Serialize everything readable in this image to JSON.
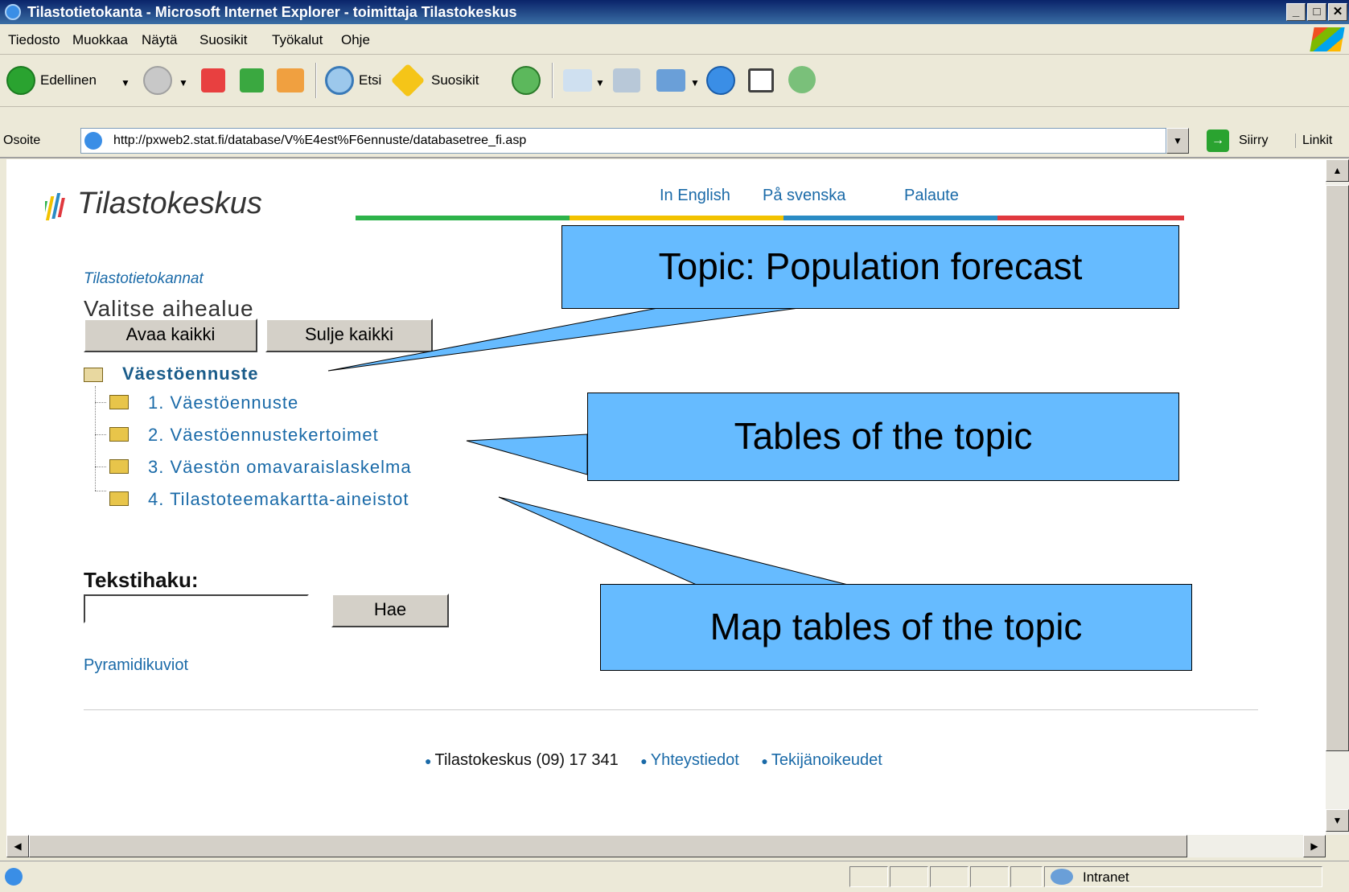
{
  "window": {
    "title": "Tilastotietokanta - Microsoft Internet Explorer - toimittaja Tilastokeskus",
    "minimize": "_",
    "maximize": "□",
    "close": "✕"
  },
  "menu": [
    "Tiedosto",
    "Muokkaa",
    "Näytä",
    "Suosikit",
    "Työkalut",
    "Ohje"
  ],
  "toolbar": {
    "back_label": "Edellinen",
    "search_label": "Etsi",
    "favorites_label": "Suosikit"
  },
  "address": {
    "label": "Osoite",
    "url": "http://pxweb2.stat.fi/database/V%E4est%F6ennuste/databasetree_fi.asp",
    "go_label": "Siirry",
    "links_label": "Linkit"
  },
  "page": {
    "logo_text": "Tilastokeskus",
    "nav": [
      "In English",
      "På svenska",
      "Palaute"
    ],
    "breadcrumb": "Tilastotietokannat",
    "heading": "Valitse aihealue",
    "open_all": "Avaa kaikki",
    "close_all": "Sulje kaikki",
    "tree": {
      "root": "Väestöennuste",
      "items": [
        "1. Väestöennuste",
        "2. Väestöennustekertoimet",
        "3. Väestön omavaraislaskelma",
        "4. Tilastoteemakartta-aineistot"
      ]
    },
    "search_label": "Tekstihaku:",
    "search_button": "Hae",
    "pyramid_link": "Pyramidikuviot",
    "footer": [
      "Tilastokeskus (09) 17 341",
      "Yhteystiedot",
      "Tekijänoikeudet"
    ]
  },
  "callouts": {
    "topic": "Topic: Population forecast",
    "tables": "Tables of the topic",
    "maps": "Map tables of the topic"
  },
  "status": {
    "zone": "Intranet"
  },
  "colors": {
    "link": "#1a6aa8",
    "callout_fill": "#66bbff",
    "stripe_green": "#2db34a",
    "stripe_yellow": "#f2c200",
    "stripe_blue": "#2a8bc4",
    "stripe_red": "#e0383e"
  }
}
